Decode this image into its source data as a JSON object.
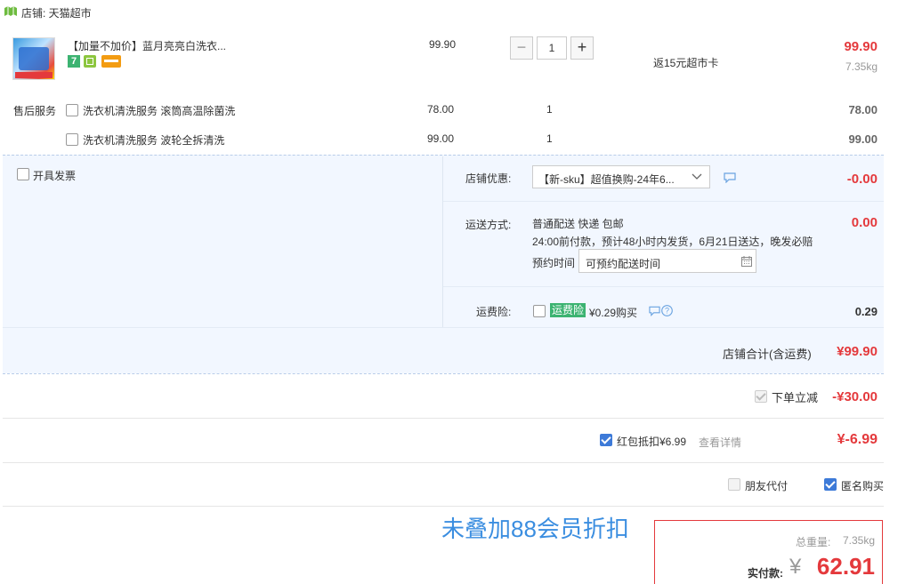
{
  "shop": {
    "label": "店铺: 天猫超市"
  },
  "product": {
    "title": "【加量不加价】蓝月亮亮白洗衣...",
    "unit_price": "99.90",
    "quantity": "1",
    "rebate": "返15元超市卡",
    "subtotal": "99.90",
    "weight": "7.35kg",
    "badges": [
      "7",
      "gift-icon",
      "card-icon"
    ]
  },
  "services": {
    "label": "售后服务",
    "items": [
      {
        "name": "洗衣机清洗服务 滚筒高温除菌洗",
        "price": "78.00",
        "qty": "1",
        "total": "78.00",
        "checked": false
      },
      {
        "name": "洗衣机清洗服务 波轮全拆清洗",
        "price": "99.00",
        "qty": "1",
        "total": "99.00",
        "checked": false
      }
    ]
  },
  "invoice": {
    "label": "开具发票",
    "checked": false
  },
  "discount": {
    "label": "店铺优惠:",
    "select_value": "【新-sku】超值换购-24年6...",
    "amount": "-0.00"
  },
  "delivery": {
    "label": "运送方式:",
    "method": "普通配送 快递 包邮",
    "detail": "24:00前付款，预计48小时内发货，6月21日送达，晚发必赔",
    "appointment_label": "预约时间",
    "appointment_placeholder": "可预约配送时间",
    "amount": "0.00"
  },
  "insurance": {
    "label": "运费险:",
    "tag": "运费险",
    "text": "¥0.29购买",
    "amount": "0.29",
    "checked": false
  },
  "shop_total": {
    "label": "店铺合计(含运费)",
    "amount": "¥99.90"
  },
  "instant_discount": {
    "label": "下单立减",
    "amount": "-¥30.00",
    "checked": true
  },
  "redpacket": {
    "label": "红包抵扣¥6.99",
    "link": "查看详情",
    "amount": "¥-6.99",
    "checked": true
  },
  "options": {
    "friend_pay": {
      "label": "朋友代付",
      "checked": false
    },
    "anonymous": {
      "label": "匿名购买",
      "checked": true
    }
  },
  "annotation": "未叠加88会员折扣",
  "summary": {
    "weight_label": "总重量:",
    "weight": "7.35kg",
    "pay_label": "实付款:",
    "currency": "¥",
    "pay_amount": "62.91"
  },
  "colors": {
    "price_red": "#e4393c",
    "accent_blue": "#3d7ad8",
    "annotation_blue": "#3b8ee0",
    "panel_bg": "#f2f7ff"
  }
}
